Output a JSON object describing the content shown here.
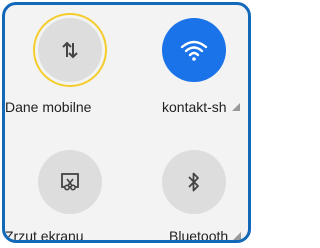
{
  "tiles": [
    {
      "label": "Dane mobilne",
      "icon": "mobile-data-icon",
      "state": "off",
      "highlighted": true,
      "signal": false
    },
    {
      "label": "kontakt-sh",
      "icon": "wifi-icon",
      "state": "on",
      "highlighted": false,
      "signal": true
    },
    {
      "label": "Zrzut ekranu",
      "icon": "screenshot-icon",
      "state": "off",
      "highlighted": false,
      "signal": false
    },
    {
      "label": "Bluetooth",
      "icon": "bluetooth-icon",
      "state": "off",
      "highlighted": false,
      "signal": true
    }
  ],
  "colors": {
    "accent": "#1a73e8",
    "frame": "#1268b9",
    "highlight": "#f4cd2a",
    "tile_off": "#dddddd"
  }
}
